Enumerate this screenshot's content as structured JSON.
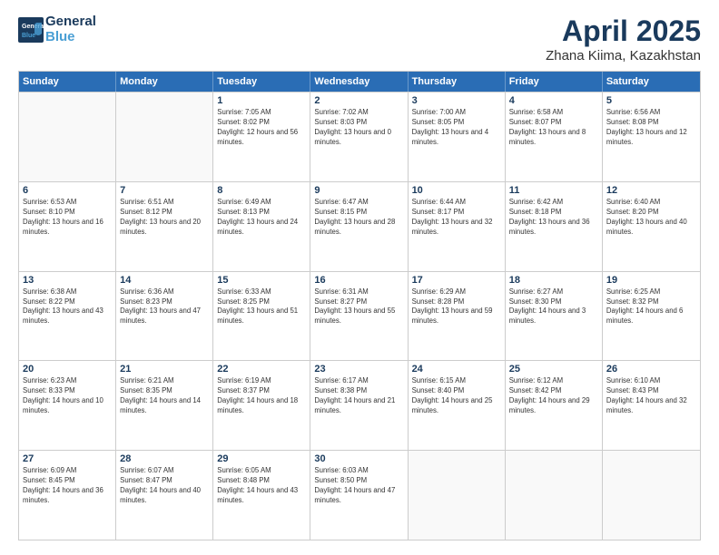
{
  "header": {
    "logo_line1": "General",
    "logo_line2": "Blue",
    "main_title": "April 2025",
    "subtitle": "Zhana Kiima, Kazakhstan"
  },
  "calendar": {
    "days_of_week": [
      "Sunday",
      "Monday",
      "Tuesday",
      "Wednesday",
      "Thursday",
      "Friday",
      "Saturday"
    ],
    "rows": [
      [
        {
          "day": "",
          "empty": true
        },
        {
          "day": "",
          "empty": true
        },
        {
          "day": "1",
          "sunrise": "Sunrise: 7:05 AM",
          "sunset": "Sunset: 8:02 PM",
          "daylight": "Daylight: 12 hours and 56 minutes."
        },
        {
          "day": "2",
          "sunrise": "Sunrise: 7:02 AM",
          "sunset": "Sunset: 8:03 PM",
          "daylight": "Daylight: 13 hours and 0 minutes."
        },
        {
          "day": "3",
          "sunrise": "Sunrise: 7:00 AM",
          "sunset": "Sunset: 8:05 PM",
          "daylight": "Daylight: 13 hours and 4 minutes."
        },
        {
          "day": "4",
          "sunrise": "Sunrise: 6:58 AM",
          "sunset": "Sunset: 8:07 PM",
          "daylight": "Daylight: 13 hours and 8 minutes."
        },
        {
          "day": "5",
          "sunrise": "Sunrise: 6:56 AM",
          "sunset": "Sunset: 8:08 PM",
          "daylight": "Daylight: 13 hours and 12 minutes."
        }
      ],
      [
        {
          "day": "6",
          "sunrise": "Sunrise: 6:53 AM",
          "sunset": "Sunset: 8:10 PM",
          "daylight": "Daylight: 13 hours and 16 minutes."
        },
        {
          "day": "7",
          "sunrise": "Sunrise: 6:51 AM",
          "sunset": "Sunset: 8:12 PM",
          "daylight": "Daylight: 13 hours and 20 minutes."
        },
        {
          "day": "8",
          "sunrise": "Sunrise: 6:49 AM",
          "sunset": "Sunset: 8:13 PM",
          "daylight": "Daylight: 13 hours and 24 minutes."
        },
        {
          "day": "9",
          "sunrise": "Sunrise: 6:47 AM",
          "sunset": "Sunset: 8:15 PM",
          "daylight": "Daylight: 13 hours and 28 minutes."
        },
        {
          "day": "10",
          "sunrise": "Sunrise: 6:44 AM",
          "sunset": "Sunset: 8:17 PM",
          "daylight": "Daylight: 13 hours and 32 minutes."
        },
        {
          "day": "11",
          "sunrise": "Sunrise: 6:42 AM",
          "sunset": "Sunset: 8:18 PM",
          "daylight": "Daylight: 13 hours and 36 minutes."
        },
        {
          "day": "12",
          "sunrise": "Sunrise: 6:40 AM",
          "sunset": "Sunset: 8:20 PM",
          "daylight": "Daylight: 13 hours and 40 minutes."
        }
      ],
      [
        {
          "day": "13",
          "sunrise": "Sunrise: 6:38 AM",
          "sunset": "Sunset: 8:22 PM",
          "daylight": "Daylight: 13 hours and 43 minutes."
        },
        {
          "day": "14",
          "sunrise": "Sunrise: 6:36 AM",
          "sunset": "Sunset: 8:23 PM",
          "daylight": "Daylight: 13 hours and 47 minutes."
        },
        {
          "day": "15",
          "sunrise": "Sunrise: 6:33 AM",
          "sunset": "Sunset: 8:25 PM",
          "daylight": "Daylight: 13 hours and 51 minutes."
        },
        {
          "day": "16",
          "sunrise": "Sunrise: 6:31 AM",
          "sunset": "Sunset: 8:27 PM",
          "daylight": "Daylight: 13 hours and 55 minutes."
        },
        {
          "day": "17",
          "sunrise": "Sunrise: 6:29 AM",
          "sunset": "Sunset: 8:28 PM",
          "daylight": "Daylight: 13 hours and 59 minutes."
        },
        {
          "day": "18",
          "sunrise": "Sunrise: 6:27 AM",
          "sunset": "Sunset: 8:30 PM",
          "daylight": "Daylight: 14 hours and 3 minutes."
        },
        {
          "day": "19",
          "sunrise": "Sunrise: 6:25 AM",
          "sunset": "Sunset: 8:32 PM",
          "daylight": "Daylight: 14 hours and 6 minutes."
        }
      ],
      [
        {
          "day": "20",
          "sunrise": "Sunrise: 6:23 AM",
          "sunset": "Sunset: 8:33 PM",
          "daylight": "Daylight: 14 hours and 10 minutes."
        },
        {
          "day": "21",
          "sunrise": "Sunrise: 6:21 AM",
          "sunset": "Sunset: 8:35 PM",
          "daylight": "Daylight: 14 hours and 14 minutes."
        },
        {
          "day": "22",
          "sunrise": "Sunrise: 6:19 AM",
          "sunset": "Sunset: 8:37 PM",
          "daylight": "Daylight: 14 hours and 18 minutes."
        },
        {
          "day": "23",
          "sunrise": "Sunrise: 6:17 AM",
          "sunset": "Sunset: 8:38 PM",
          "daylight": "Daylight: 14 hours and 21 minutes."
        },
        {
          "day": "24",
          "sunrise": "Sunrise: 6:15 AM",
          "sunset": "Sunset: 8:40 PM",
          "daylight": "Daylight: 14 hours and 25 minutes."
        },
        {
          "day": "25",
          "sunrise": "Sunrise: 6:12 AM",
          "sunset": "Sunset: 8:42 PM",
          "daylight": "Daylight: 14 hours and 29 minutes."
        },
        {
          "day": "26",
          "sunrise": "Sunrise: 6:10 AM",
          "sunset": "Sunset: 8:43 PM",
          "daylight": "Daylight: 14 hours and 32 minutes."
        }
      ],
      [
        {
          "day": "27",
          "sunrise": "Sunrise: 6:09 AM",
          "sunset": "Sunset: 8:45 PM",
          "daylight": "Daylight: 14 hours and 36 minutes."
        },
        {
          "day": "28",
          "sunrise": "Sunrise: 6:07 AM",
          "sunset": "Sunset: 8:47 PM",
          "daylight": "Daylight: 14 hours and 40 minutes."
        },
        {
          "day": "29",
          "sunrise": "Sunrise: 6:05 AM",
          "sunset": "Sunset: 8:48 PM",
          "daylight": "Daylight: 14 hours and 43 minutes."
        },
        {
          "day": "30",
          "sunrise": "Sunrise: 6:03 AM",
          "sunset": "Sunset: 8:50 PM",
          "daylight": "Daylight: 14 hours and 47 minutes."
        },
        {
          "day": "",
          "empty": true
        },
        {
          "day": "",
          "empty": true
        },
        {
          "day": "",
          "empty": true
        }
      ]
    ]
  }
}
